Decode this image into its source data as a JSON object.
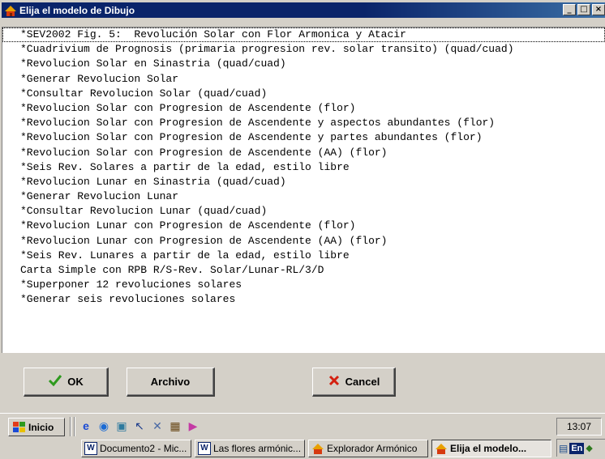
{
  "window": {
    "title": "Elija el modelo de Dibujo",
    "controls": {
      "minimize": "_",
      "maximize": "□",
      "close": "×"
    }
  },
  "list": {
    "items": [
      "*SEV2002 Fig. 5:  Revolución Solar con Flor Armonica y Atacir",
      "*Cuadrivium de Prognosis (primaria progresion rev. solar transito) (quad/cuad)",
      "*Revolucion Solar en Sinastria (quad/cuad)",
      "*Generar Revolucion Solar",
      "*Consultar Revolucion Solar (quad/cuad)",
      "*Revolucion Solar con Progresion de Ascendente (flor)",
      "*Revolucion Solar con Progresion de Ascendente y aspectos abundantes (flor)",
      "*Revolucion Solar con Progresion de Ascendente y partes abundantes (flor)",
      "*Revolucion Solar con Progresion de Ascendente (AA) (flor)",
      "*Seis Rev. Solares a partir de la edad, estilo libre",
      "*Revolucion Lunar en Sinastria (quad/cuad)",
      "*Generar Revolucion Lunar",
      "*Consultar Revolucion Lunar (quad/cuad)",
      "*Revolucion Lunar con Progresion de Ascendente (flor)",
      "*Revolucion Lunar con Progresion de Ascendente (AA) (flor)",
      "*Seis Rev. Lunares a partir de la edad, estilo libre",
      "Carta Simple con RPB R/S-Rev. Solar/Lunar-RL/3/D",
      "*Superponer 12 revoluciones solares",
      "*Generar seis revoluciones solares"
    ]
  },
  "buttons": {
    "ok": "OK",
    "archivo": "Archivo",
    "cancel": "Cancel"
  },
  "taskbar": {
    "start": "Inicio",
    "clock": "13:07",
    "language": "En",
    "tasks": [
      "Documento2 - Mic...",
      "Las flores armónic...",
      "Explorador Armónico",
      "Elija el modelo..."
    ]
  },
  "colors": {
    "titlebar": "#0a246a",
    "face": "#d4d0c8",
    "ok_check": "#2e9a1e",
    "cancel_x": "#d42010"
  }
}
